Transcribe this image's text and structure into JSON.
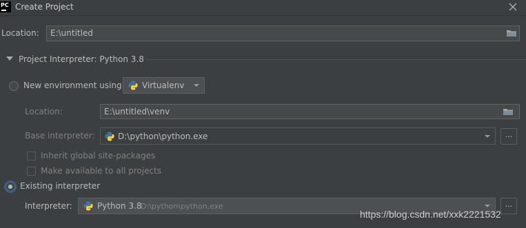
{
  "window": {
    "title": "Create Project"
  },
  "location": {
    "label": "Location:",
    "value": "E:\\untitled"
  },
  "section": {
    "header": "Project Interpreter: Python 3.8"
  },
  "new_env": {
    "radio_label": "New environment using",
    "tool": "Virtualenv",
    "location_label": "Location:",
    "location_value": "E:\\untitled\\venv",
    "base_label": "Base interpreter:",
    "base_value": "D:\\python\\python.exe",
    "browse": "...",
    "inherit_label": "Inherit global site-packages",
    "make_available_label": "Make available to all projects"
  },
  "existing": {
    "radio_label": "Existing interpreter",
    "interpreter_label": "Interpreter:",
    "interpreter_name": "Python 3.8",
    "interpreter_path": "D:\\python\\python.exe"
  },
  "watermark": "https://blog.csdn.net/xxk2221532",
  "colors": {
    "background": "#3c3f41",
    "field": "#45494a",
    "selection_ring": "#3d6185",
    "text": "#bbbbbb"
  }
}
